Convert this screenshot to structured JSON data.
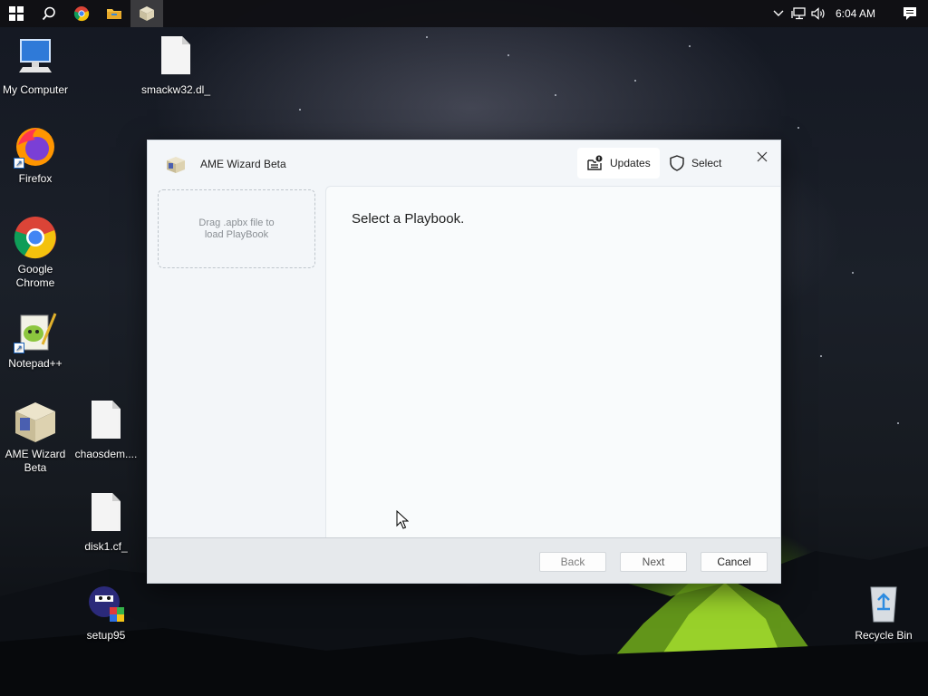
{
  "taskbar": {
    "items": [
      "start",
      "search",
      "chrome",
      "file-explorer",
      "ame-wizard"
    ],
    "clock": "6:04 AM"
  },
  "desktop": {
    "icons": [
      {
        "label": "My Computer"
      },
      {
        "label": "smackw32.dl_"
      },
      {
        "label": "Firefox"
      },
      {
        "label": "Google Chrome"
      },
      {
        "label": "Notepad++"
      },
      {
        "label": "AME Wizard Beta"
      },
      {
        "label": "chaosdem...."
      },
      {
        "label": "disk1.cf_"
      },
      {
        "label": "setup95"
      },
      {
        "label": "Recycle Bin"
      }
    ]
  },
  "window": {
    "title": "AME Wizard Beta",
    "updates_label": "Updates",
    "select_label": "Select",
    "dropzone_text": "Drag .apbx file to load PlayBook",
    "content_title": "Select a Playbook.",
    "footer": {
      "back_label": "Back",
      "next_label": "Next",
      "cancel_label": "Cancel"
    }
  }
}
